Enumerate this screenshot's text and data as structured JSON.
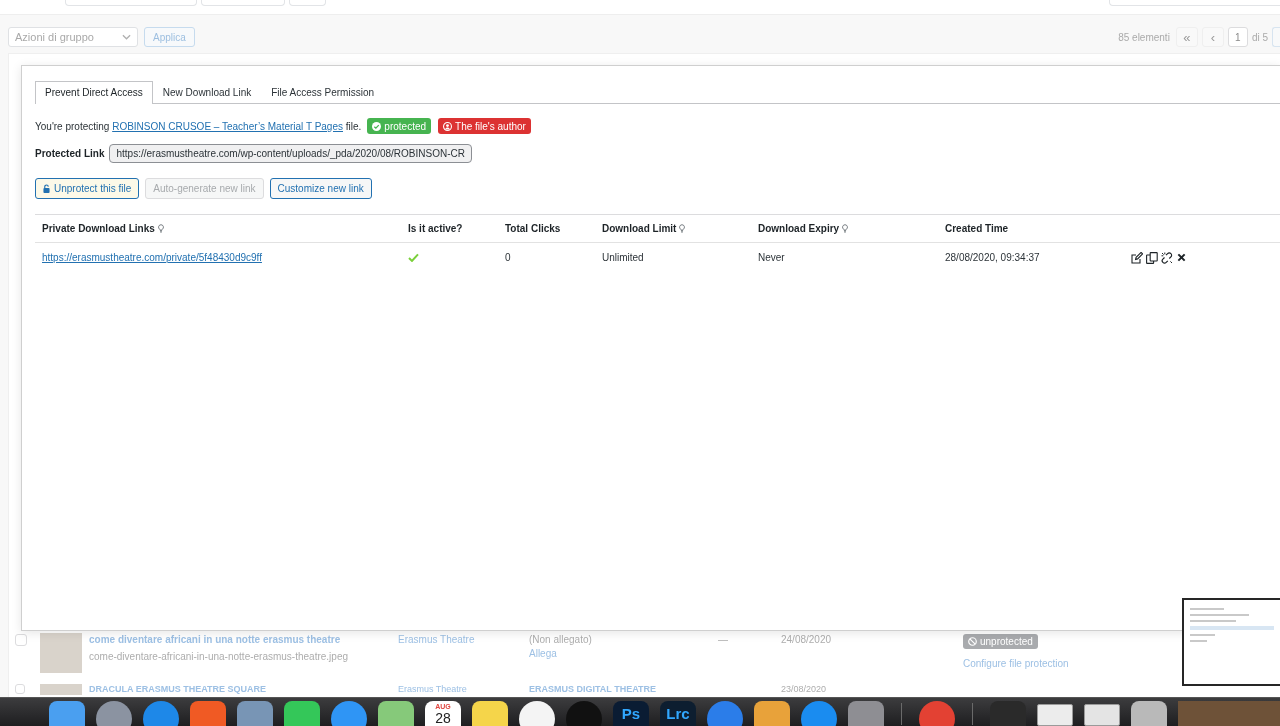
{
  "bulk_actions": {
    "dropdown": "Azioni di gruppo",
    "apply": "Applica"
  },
  "pagination": {
    "count": "85 elementi",
    "first": "«",
    "previous": "‹",
    "page": "1",
    "total": "di 5"
  },
  "modal": {
    "tabs": [
      {
        "label": "Prevent Direct Access",
        "selected": true
      },
      {
        "label": "New Download Link",
        "selected": false
      },
      {
        "label": "File Access Permission",
        "selected": false
      }
    ],
    "protecting": {
      "before": "You're protecting",
      "link": "ROBINSON CRUSOE – Teacher’s Material T Pages",
      "after": "file."
    },
    "badges": [
      {
        "label": "protected",
        "kind": "protected",
        "color": "#46b450"
      },
      {
        "label": "The file's author",
        "kind": "author",
        "color": "#dc3232"
      }
    ],
    "protected_link": {
      "label": "Protected Link",
      "value": "https://erasmustheatre.com/wp-content/uploads/_pda/2020/08/ROBINSON-CR"
    },
    "actions": [
      {
        "label": "Unprotect this file",
        "kind": "unprotect",
        "disabled": false
      },
      {
        "label": "Auto-generate new link",
        "kind": "plain",
        "disabled": true
      },
      {
        "label": "Customize new link",
        "kind": "plain",
        "disabled": false
      }
    ],
    "links_table": {
      "columns": [
        {
          "label": "Private Download Links",
          "hint": true
        },
        {
          "label": "Is it active?",
          "hint": false
        },
        {
          "label": "Total Clicks",
          "hint": false
        },
        {
          "label": "Download Limit",
          "hint": true
        },
        {
          "label": "Download Expiry",
          "hint": true
        },
        {
          "label": "Created Time",
          "hint": false
        }
      ],
      "rows": [
        {
          "url": "https://erasmustheatre.com/private/5f48430d9c9ff",
          "active": true,
          "clicks": "0",
          "limit": "Unlimited",
          "expiry": "Never",
          "created": "28/08/2020, 09:34:37"
        }
      ]
    }
  },
  "media_rows": [
    {
      "checked": false,
      "title": "come diventare africani in una notte erasmus theatre",
      "filename": "come-diventare-africani-in-una-notte-erasmus-theatre.jpeg",
      "author": "Erasmus Theatre",
      "attached": "(Non allegato)",
      "attach_link": "Allega",
      "comments": "—",
      "date": "24/08/2020",
      "protection": "unprotected",
      "protection_link": "Configure file protection"
    },
    {
      "checked": false,
      "title": "DRACULA ERASMUS THEATRE SQUARE",
      "author": "Erasmus Theatre",
      "attached": "ERASMUS DIGITAL THEATRE",
      "date": "23/08/2020"
    }
  ],
  "dock": {
    "items": [
      {
        "kind": "tile",
        "color": "#4a9ff0"
      },
      {
        "kind": "round",
        "color": "#8b93a1"
      },
      {
        "kind": "round",
        "color": "#1e88e8"
      },
      {
        "kind": "tile",
        "color": "#f05a24"
      },
      {
        "kind": "tile",
        "color": "#7895b5"
      },
      {
        "kind": "tile",
        "color": "#34c759"
      },
      {
        "kind": "round",
        "color": "#2f95f5"
      },
      {
        "kind": "tile",
        "color": "#86c97a"
      },
      {
        "kind": "calendar",
        "month": "AUG",
        "day": "28"
      },
      {
        "kind": "tile",
        "color": "#f5d54a"
      },
      {
        "kind": "round",
        "color": "#f4f4f4"
      },
      {
        "kind": "round",
        "color": "#111111"
      },
      {
        "kind": "text-tile",
        "color": "#0a1c33",
        "label": "Ps"
      },
      {
        "kind": "text-tile",
        "color": "#0d1e30",
        "label": "Lrc"
      },
      {
        "kind": "round",
        "color": "#2b7de9"
      },
      {
        "kind": "tile",
        "color": "#e8a23a"
      },
      {
        "kind": "round",
        "color": "#1a8cf0"
      },
      {
        "kind": "tile",
        "color": "#8e8e93"
      },
      {
        "kind": "separator"
      },
      {
        "kind": "round",
        "color": "#e34133"
      },
      {
        "kind": "separator"
      },
      {
        "kind": "tile",
        "color": "#2a2a2a"
      },
      {
        "kind": "window",
        "color": "#ececec"
      },
      {
        "kind": "window",
        "color": "#e4e4e4"
      },
      {
        "kind": "tile",
        "color": "#b9b9b9"
      },
      {
        "kind": "photo",
        "color": "#6e5238"
      }
    ]
  }
}
